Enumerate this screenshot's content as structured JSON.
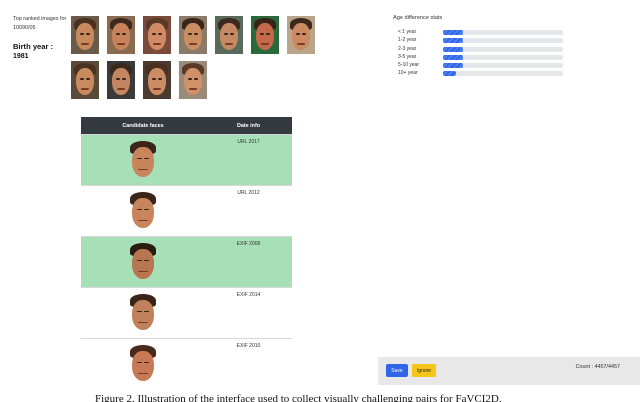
{
  "sidebar": {
    "ranked_caption": "Top ranked images for 10090/05",
    "birth_label": "Birth year :",
    "birth_value": "1981"
  },
  "thumbnails": [
    {
      "skin": "#c88a5c",
      "hair": "#4a3020",
      "bg": "#6a5a4a"
    },
    {
      "skin": "#c8825a",
      "hair": "#3e2a1c",
      "bg": "#8a6a50"
    },
    {
      "skin": "#d08a66",
      "hair": "#5a3a26",
      "bg": "#7a4a3a"
    },
    {
      "skin": "#c98d62",
      "hair": "#3a2618",
      "bg": "#8a7a6a"
    },
    {
      "skin": "#c68a62",
      "hair": "#3a2a20",
      "bg": "#5a6a5a"
    },
    {
      "skin": "#c46a4a",
      "hair": "#3a2216",
      "bg": "#2a6a3a"
    },
    {
      "skin": "#cc8a60",
      "hair": "#3e2a1c",
      "bg": "#b8a58a"
    },
    {
      "skin": "#c88a5e",
      "hair": "#4a3222",
      "bg": "#5a4a3a"
    },
    {
      "skin": "#c48660",
      "hair": "#3a2a1e",
      "bg": "#3a3a3a"
    },
    {
      "skin": "#cc8c64",
      "hair": "#4a3020",
      "bg": "#4a3a30"
    },
    {
      "skin": "#d09068",
      "hair": "#5a3a26",
      "bg": "#9a8a7a"
    }
  ],
  "stats": {
    "title": "Age difference stats",
    "rows": [
      {
        "label": "< 1 year",
        "value": 0.17
      },
      {
        "label": "1-2 year",
        "value": 0.17
      },
      {
        "label": "2-3 year",
        "value": 0.17
      },
      {
        "label": "3-5 year",
        "value": 0.17
      },
      {
        "label": "5-10 year",
        "value": 0.17
      },
      {
        "label": "10+ year",
        "value": 0.11
      }
    ]
  },
  "table": {
    "header_faces": "Candidate faces",
    "header_info": "Date info",
    "rows": [
      {
        "info": "URL 2017",
        "highlighted": true,
        "skin": "#c8845a",
        "hair": "#3a2618",
        "bg": "#b4a48c"
      },
      {
        "info": "URL 2012",
        "highlighted": false,
        "skin": "#c8845a",
        "hair": "#3a2618",
        "bg": "#7a6a58"
      },
      {
        "info": "EXIF 2009",
        "highlighted": true,
        "skin": "#b87650",
        "hair": "#2a1a10",
        "bg": "#2a5a32"
      },
      {
        "info": "EXIF 2014",
        "highlighted": false,
        "skin": "#c0805a",
        "hair": "#3a2418",
        "bg": "#3a3a44"
      },
      {
        "info": "EXIF 2010",
        "highlighted": false,
        "skin": "#c87a56",
        "hair": "#4a2a1a",
        "bg": "#b8b0a4"
      }
    ]
  },
  "footer": {
    "save_label": "Save",
    "ignore_label": "Ignore",
    "count": "Count : 4457/4457"
  },
  "caption": "Figure 2. Illustration of the interface used to collect visually challenging pairs for FaVCI2D."
}
